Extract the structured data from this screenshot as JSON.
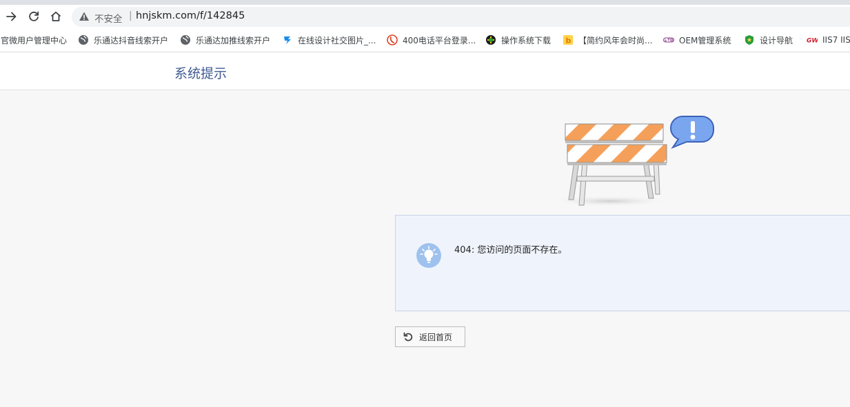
{
  "browser": {
    "insecure_label": "不安全",
    "separator": "|",
    "url": "hnjskm.com/f/142845",
    "bookmarks": [
      {
        "label": "官微用户管理中心",
        "icon": "none"
      },
      {
        "label": "乐通达抖音线索开户",
        "icon": "globe-icon"
      },
      {
        "label": "乐通达加推线索开户",
        "icon": "globe-icon"
      },
      {
        "label": "在线设计社交图片_...",
        "icon": "design-site-icon"
      },
      {
        "label": "400电话平台登录...",
        "icon": "phone-platform-icon"
      },
      {
        "label": "操作系统下载",
        "icon": "os-download-icon"
      },
      {
        "label": "【简约风年会时尚...",
        "icon": "b-icon"
      },
      {
        "label": "OEM管理系统",
        "icon": "ltd-icon"
      },
      {
        "label": "设计导航",
        "icon": "shield-star-icon"
      },
      {
        "label": "IIS7 IIS",
        "icon": "gw-icon"
      }
    ]
  },
  "page": {
    "header_title": "系统提示",
    "message": "404: 您访问的页面不存在。",
    "back_button": "返回首页"
  },
  "colors": {
    "accent_title": "#3e5a92",
    "message_bg": "#eff4fc",
    "message_border": "#c7d3e6",
    "barricade_orange": "#f5a05a"
  }
}
